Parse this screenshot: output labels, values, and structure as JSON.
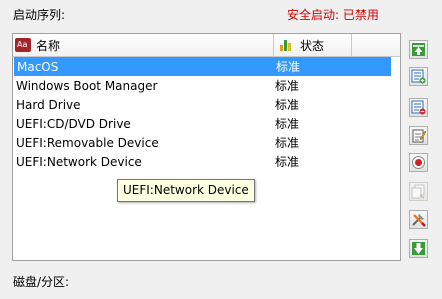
{
  "boot_order_label": "启动序列:",
  "secure_boot_text": "安全启动: 已禁用",
  "disk_partition_label": "磁盘/分区:",
  "columns": {
    "name": "名称",
    "status": "状态"
  },
  "boot_entries": [
    {
      "name": "MacOS",
      "status": "标准"
    },
    {
      "name": "Windows Boot Manager",
      "status": "标准"
    },
    {
      "name": "Hard Drive",
      "status": "标准"
    },
    {
      "name": "UEFI:CD/DVD Drive",
      "status": "标准"
    },
    {
      "name": "UEFI:Removable Device",
      "status": "标准"
    },
    {
      "name": "UEFI:Network Device",
      "status": "标准"
    }
  ],
  "tooltip": "UEFI:Network Device",
  "toolbar_icons": [
    "move-to-top-icon",
    "add-entry-icon",
    "delete-entry-icon",
    "edit-entry-icon",
    "record-icon",
    "copy-entry-icon",
    "tools-icon",
    "move-down-icon"
  ],
  "colors": {
    "selection": "#3399ff",
    "secure_boot_text": "#d40000",
    "tooltip_bg": "#ffffe1"
  }
}
